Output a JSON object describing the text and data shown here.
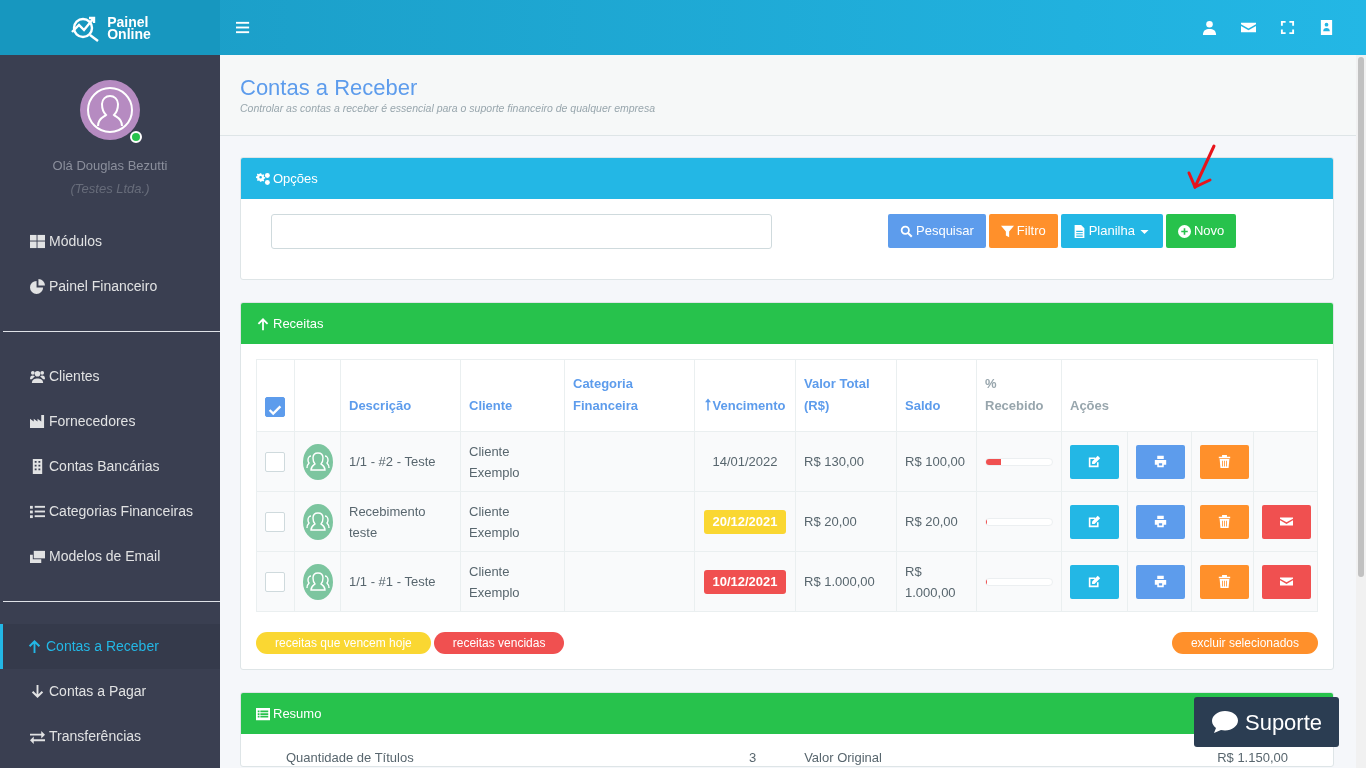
{
  "brand": {
    "line1": "Painel",
    "line2": "Online"
  },
  "user": {
    "greeting": "Olá Douglas Bezutti",
    "company": "(Testes Ltda.)",
    "online": true
  },
  "sidebar": {
    "groups": [
      [
        {
          "label": "Módulos",
          "selected": false
        },
        {
          "label": "Painel Financeiro",
          "selected": false
        }
      ],
      [
        {
          "label": "Clientes",
          "selected": false
        },
        {
          "label": "Fornecedores",
          "selected": false
        },
        {
          "label": "Contas Bancárias",
          "selected": false
        },
        {
          "label": "Categorias Financeiras",
          "selected": false
        },
        {
          "label": "Modelos de Email",
          "selected": false
        }
      ],
      [
        {
          "label": "Contas a Receber",
          "selected": true
        },
        {
          "label": "Contas a Pagar",
          "selected": false
        },
        {
          "label": "Transferências",
          "selected": false
        }
      ]
    ]
  },
  "page": {
    "title": "Contas a Receber",
    "subtitle": "Controlar as contas a receber é essencial para o suporte financeiro de qualquer empresa"
  },
  "options": {
    "title": "Opções",
    "buttons": [
      {
        "label": "Pesquisar",
        "kind": "search"
      },
      {
        "label": "Filtro",
        "kind": "filter"
      },
      {
        "label": "Planilha",
        "kind": "sheet"
      },
      {
        "label": "Novo",
        "kind": "new"
      }
    ]
  },
  "receitas": {
    "title": "Receitas",
    "select_all": {
      "checked": true
    },
    "columns": [
      {
        "label": "Descrição",
        "sortable": true,
        "sorted": false
      },
      {
        "label": "Cliente",
        "sortable": true,
        "sorted": false
      },
      {
        "label": "Categoria Financeira",
        "sortable": true,
        "sorted": false
      },
      {
        "label": "Vencimento",
        "sortable": true,
        "sorted": true
      },
      {
        "label": "Valor Total (R$)",
        "sortable": true,
        "sorted": false
      },
      {
        "label": "Saldo",
        "sortable": true,
        "sorted": false
      },
      {
        "label": "% Recebido",
        "sortable": false,
        "sorted": false
      },
      {
        "label": "Ações",
        "sortable": false,
        "sorted": false
      }
    ],
    "rows": [
      {
        "checked": false,
        "description": "1/1 - #2 - Teste",
        "client": "Cliente Exemplo",
        "due": {
          "text": "14/01/2022",
          "kind": "normal"
        },
        "total": "R$ 130,00",
        "balance": "R$ 100,00",
        "level": 0.23,
        "actions": [
          {
            "kind": "edit"
          },
          {
            "kind": "print"
          },
          {
            "kind": "delete"
          }
        ]
      },
      {
        "checked": false,
        "description": "Recebimento teste",
        "client": "Cliente Exemplo",
        "due": {
          "text": "20/12/2021",
          "kind": "today"
        },
        "total": "R$ 20,00",
        "balance": "R$ 20,00",
        "level": 0,
        "actions": [
          {
            "kind": "edit"
          },
          {
            "kind": "print"
          },
          {
            "kind": "delete"
          },
          {
            "kind": "email"
          }
        ]
      },
      {
        "checked": false,
        "description": "1/1 - #1 - Teste",
        "client": "Cliente Exemplo",
        "due": {
          "text": "10/12/2021",
          "kind": "overdue"
        },
        "total": "R$ 1.000,00",
        "balance": "R$ 1.000,00",
        "level": 0,
        "actions": [
          {
            "kind": "edit"
          },
          {
            "kind": "print"
          },
          {
            "kind": "delete"
          },
          {
            "kind": "email"
          }
        ]
      }
    ],
    "legend": [
      {
        "label": "receitas que vencem hoje",
        "kind": "today"
      },
      {
        "label": "receitas vencidas",
        "kind": "overdue"
      }
    ],
    "bulk_action": {
      "label": "excluir selecionados"
    }
  },
  "resumo": {
    "title": "Resumo",
    "items": [
      {
        "label": "Quantidade de Títulos",
        "value": "3"
      },
      {
        "label": "Valor Original",
        "value": "R$ 1.150,00"
      }
    ]
  },
  "support": {
    "label": "Suporte"
  }
}
